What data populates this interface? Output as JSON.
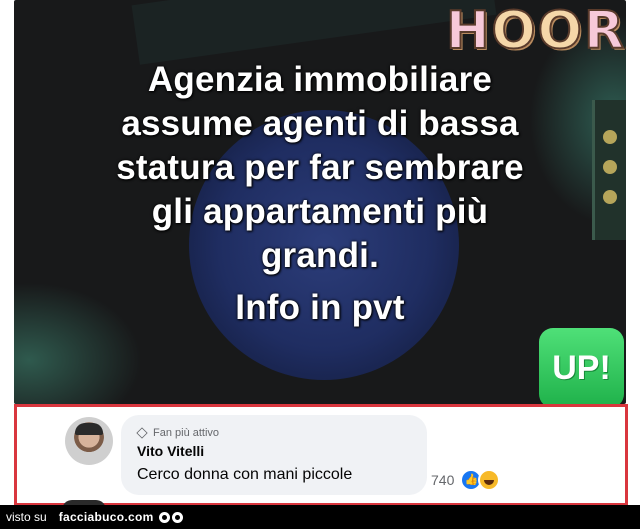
{
  "post": {
    "text_lines": [
      "Agenzia immobiliare",
      "assume agenti di bassa",
      "statura per far sembrare",
      "gli appartamenti più",
      "grandi."
    ],
    "info_line": "Info in pvt",
    "hoora_sticker": "HOORA",
    "up_badge": "UP!"
  },
  "comment": {
    "badge": "Fan più attivo",
    "author": "Vito Vitelli",
    "text": "Cerco donna con mani piccole",
    "reaction_count": "740",
    "reactions": [
      "like-icon",
      "haha-icon"
    ],
    "border_color": "#d9363e"
  },
  "footer": {
    "prefix": "visto su",
    "site": "facciabuco.com"
  }
}
